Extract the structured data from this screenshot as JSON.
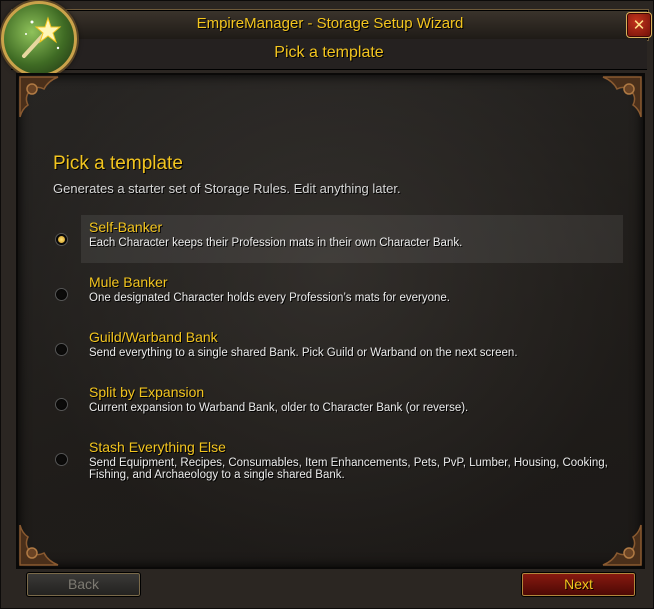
{
  "window": {
    "title": "EmpireManager - Storage Setup Wizard",
    "subtitle": "Pick a template",
    "close_symbol": "✕"
  },
  "page": {
    "heading": "Pick a template",
    "description": "Generates a starter set of Storage Rules. Edit anything later."
  },
  "options": [
    {
      "title": "Self-Banker",
      "desc": "Each Character keeps their Profession mats in their own Character Bank.",
      "selected": true
    },
    {
      "title": "Mule Banker",
      "desc": "One designated Character holds every Profession’s mats for everyone.",
      "selected": false
    },
    {
      "title": "Guild/Warband Bank",
      "desc": "Send everything to a single shared Bank. Pick Guild or Warband on the next screen.",
      "selected": false
    },
    {
      "title": "Split by Expansion",
      "desc": "Current expansion to Warband Bank, older to Character Bank (or reverse).",
      "selected": false
    },
    {
      "title": "Stash Everything Else",
      "desc": "Send Equipment, Recipes, Consumables, Item Enhancements, Pets, PvP, Lumber, Housing, Cooking, Fishing, and Archaeology to a single shared Bank.",
      "selected": false
    }
  ],
  "footer": {
    "back_label": "Back",
    "next_label": "Next"
  },
  "colors": {
    "gold_text": "#f3c51f",
    "next_button": "#8a1a10"
  }
}
